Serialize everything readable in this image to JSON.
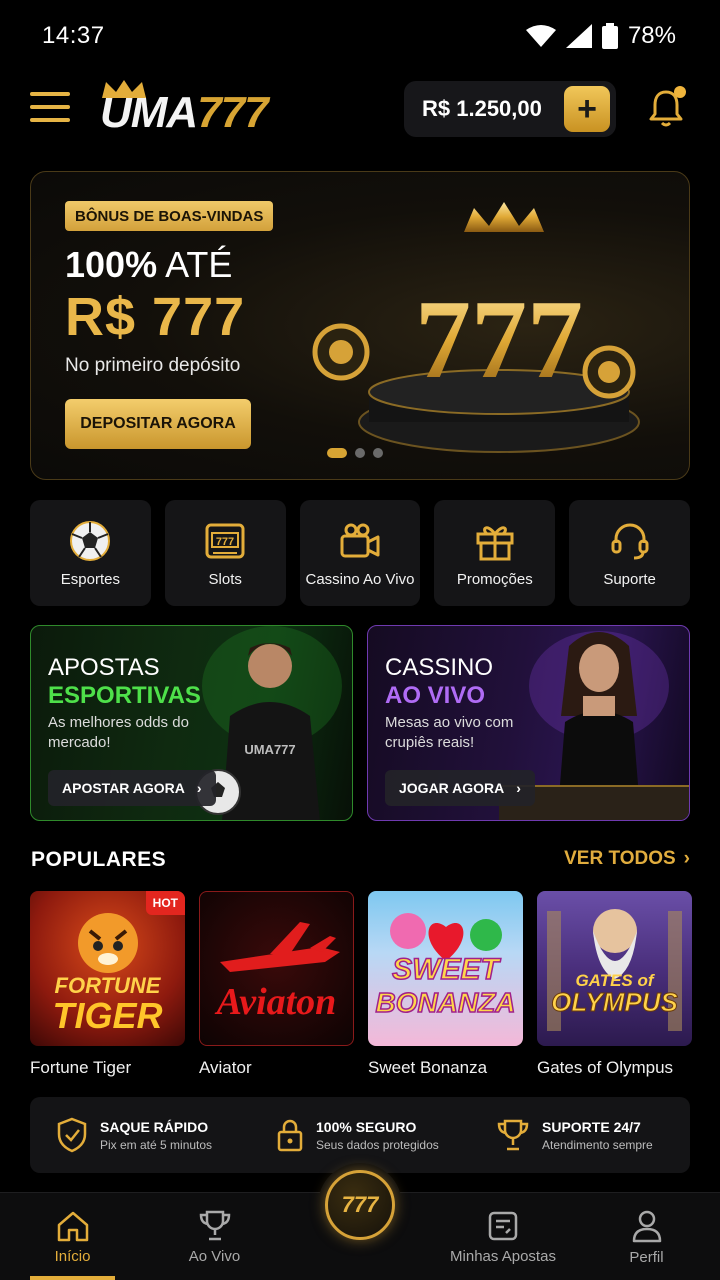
{
  "status_bar": {
    "time": "14:37",
    "battery": "78%"
  },
  "header": {
    "logo_main": "UMA",
    "logo_num": "777",
    "balance": "R$ 1.250,00",
    "add_label": "+"
  },
  "hero": {
    "tag": "BÔNUS DE BOAS-VINDAS",
    "line1_bold": "100%",
    "line1_rest": " ATÉ",
    "amount": "R$ 777",
    "subtitle": "No primeiro depósito",
    "cta": "DEPOSITAR AGORA",
    "art_text": "777",
    "slide_count": 3,
    "active_slide": 1
  },
  "categories": [
    {
      "label": "Esportes",
      "icon": "soccer-ball-icon"
    },
    {
      "label": "Slots",
      "icon": "slot-machine-icon"
    },
    {
      "label": "Cassino Ao Vivo",
      "icon": "video-camera-icon"
    },
    {
      "label": "Promoções",
      "icon": "gift-icon"
    },
    {
      "label": "Suporte",
      "icon": "headset-icon"
    }
  ],
  "promos": {
    "sport": {
      "title1": "APOSTAS",
      "title2": "ESPORTIVAS",
      "desc": "As melhores odds do mercado!",
      "cta": "APOSTAR AGORA",
      "jersey_text": "UMA777",
      "accent": "#4ee04a"
    },
    "casino": {
      "title1": "CASSINO",
      "title2": "AO VIVO",
      "desc": "Mesas ao vivo com crupiês reais!",
      "cta": "JOGAR AGORA",
      "accent": "#b06cf5"
    }
  },
  "populares": {
    "title": "POPULARES",
    "see_all": "VER TODOS",
    "games": [
      {
        "name": "Fortune Tiger",
        "badge": "HOT",
        "art_line1": "FORTUNE",
        "art_line2": "TIGER"
      },
      {
        "name": "Aviator",
        "art_line1": "Aviaton"
      },
      {
        "name": "Sweet Bonanza",
        "art_line1": "SWEET",
        "art_line2": "BONANZA"
      },
      {
        "name": "Gates of Olympus",
        "art_line1": "GATES of",
        "art_line2": "OLYMPUS"
      }
    ]
  },
  "trust": [
    {
      "title": "SAQUE RÁPIDO",
      "sub": "Pix em até 5 minutos",
      "icon": "shield-check-icon"
    },
    {
      "title": "100% SEGURO",
      "sub": "Seus dados protegidos",
      "icon": "lock-icon"
    },
    {
      "title": "SUPORTE 24/7",
      "sub": "Atendimento sempre",
      "icon": "trophy-icon"
    }
  ],
  "bottom_nav": {
    "items": [
      {
        "label": "Início",
        "icon": "home-icon",
        "active": true
      },
      {
        "label": "Ao Vivo",
        "icon": "trophy-icon"
      },
      {
        "label": "Minhas Apostas",
        "icon": "ticket-icon"
      },
      {
        "label": "Perfil",
        "icon": "user-icon"
      }
    ],
    "center_label": "777"
  },
  "colors": {
    "gold": "#e3ad3a",
    "green": "#4ee04a",
    "purple": "#b06cf5",
    "hot": "#e3261f"
  }
}
